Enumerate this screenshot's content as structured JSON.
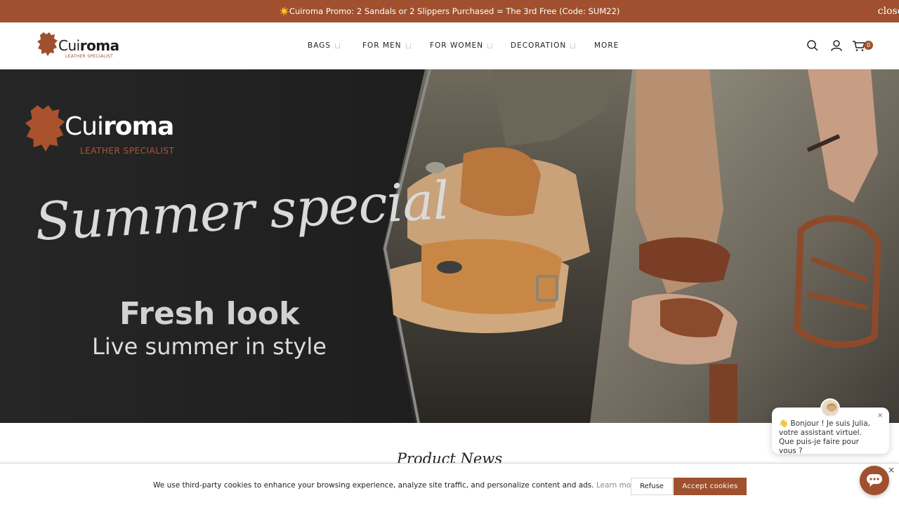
{
  "promo": {
    "text": "☀️Cuiroma Promo: 2 Sandals or 2 Slippers Purchased = The 3rd Free (Code: SUM22)",
    "close_label": "close"
  },
  "header": {
    "logo": {
      "word_light": "Cui",
      "word_bold": "roma",
      "tagline": "LEATHER SPECIALIST"
    },
    "nav": [
      {
        "label": "BAGS",
        "has_dropdown": true
      },
      {
        "label": "FOR MEN",
        "has_dropdown": true
      },
      {
        "label": "FOR WOMEN",
        "has_dropdown": true
      },
      {
        "label": "DECORATION",
        "has_dropdown": true
      },
      {
        "label": "MORE",
        "has_dropdown": false
      }
    ],
    "icons": [
      "search-icon",
      "account-icon",
      "cart-icon"
    ],
    "cart_count": "0"
  },
  "hero": {
    "logo_word_light": "Cui",
    "logo_word_bold": "roma",
    "logo_tagline": "LEATHER SPECIALIST",
    "script_text": "Summer special",
    "headline": "Fresh look",
    "subline": "Live summer in style"
  },
  "section": {
    "title": "Product News"
  },
  "cookie": {
    "text": "We use third-party cookies to enhance your browsing experience, analyze site traffic, and personalize content and ads.",
    "learn_more": "Learn more",
    "refuse_label": "Refuse",
    "accept_label": "Accept cookies"
  },
  "chat": {
    "message": "👋 Bonjour ! Je suis Julia, votre assistant virtuel. Que puis-je faire pour vous ?",
    "close_glyph": "×"
  },
  "colors": {
    "brand": "#a0502f",
    "hero_dark": "#1f1f1f"
  }
}
